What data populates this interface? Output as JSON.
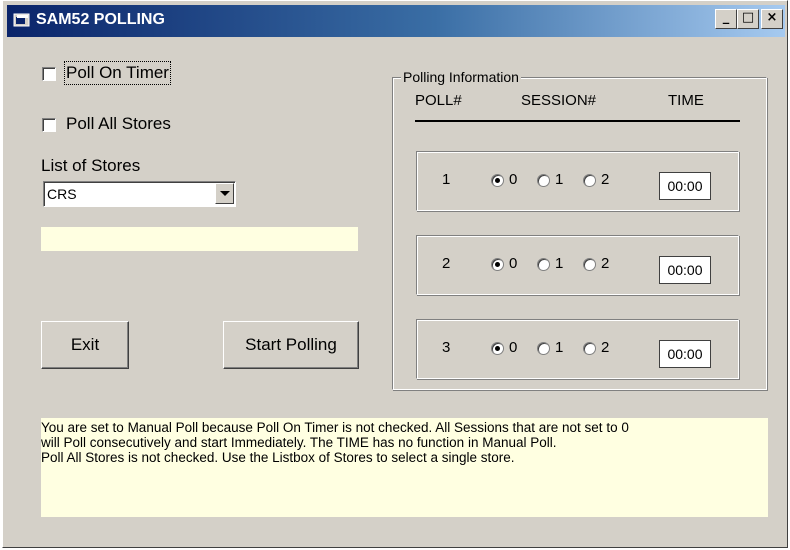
{
  "window": {
    "title": "SAM52 POLLING",
    "controls": {
      "minimize": "_",
      "maximize": "□",
      "close": "×"
    }
  },
  "options": {
    "poll_on_timer": {
      "label": "Poll On Timer",
      "checked": false
    },
    "poll_all_stores": {
      "label": "Poll All Stores",
      "checked": false
    }
  },
  "stores": {
    "label": "List of Stores",
    "selected": "CRS"
  },
  "buttons": {
    "exit": "Exit",
    "start_polling": "Start Polling"
  },
  "polling": {
    "group_title": "Polling Information",
    "headers": {
      "poll": "POLL#",
      "session": "SESSION#",
      "time": "TIME"
    },
    "session_options": [
      "0",
      "1",
      "2"
    ],
    "rows": [
      {
        "num": "1",
        "session": "0",
        "time": "00:00"
      },
      {
        "num": "2",
        "session": "0",
        "time": "00:00"
      },
      {
        "num": "3",
        "session": "0",
        "time": "00:00"
      }
    ]
  },
  "status": {
    "line1": "You are set to Manual Poll because Poll On Timer is not checked.  All Sessions that are not set to 0",
    "line2": "will Poll consecutively and start Immediately.  The TIME has no function in Manual Poll.",
    "line3": "Poll All Stores is not checked.  Use the Listbox of Stores to select a single store."
  },
  "colors": {
    "title_start": "#0a246a",
    "title_end": "#a6caf0",
    "face": "#d4d0c8",
    "info_background": "#ffffe1"
  }
}
